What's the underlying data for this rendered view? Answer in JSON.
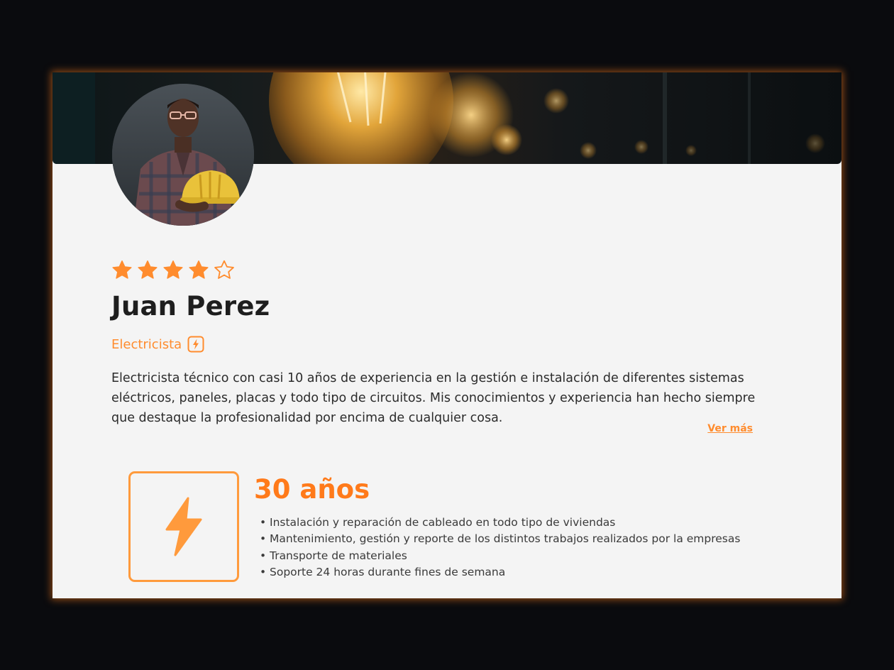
{
  "profile": {
    "name": "Juan Perez",
    "profession": "Electricista",
    "profession_icon": "bolt-icon",
    "rating": 4,
    "rating_max": 5,
    "description": "Electricista técnico con casi 10 años de experiencia en la gestión e instalación de diferentes sistemas eléctricos, paneles, placas y todo tipo de circuitos. Mis conocimientos y experiencia han hecho siempre que destaque la profesionalidad por encima de cualquier cosa.",
    "read_more_label": "Ver más"
  },
  "experience": {
    "years_label": "30 años",
    "icon": "bolt-icon",
    "items": [
      "Instalación y reparación de cableado en todo tipo de viviendas",
      "Mantenimiento, gestión y reporte de los distintos trabajos realizados por la empresas",
      "Transporte de materiales",
      "Soporte 24 horas durante fines de semana"
    ]
  },
  "colors": {
    "accent": "#ff8c2e",
    "accent_strong": "#ff7a1a",
    "card_background": "#f4f4f4",
    "page_background": "#0a0b0e"
  }
}
